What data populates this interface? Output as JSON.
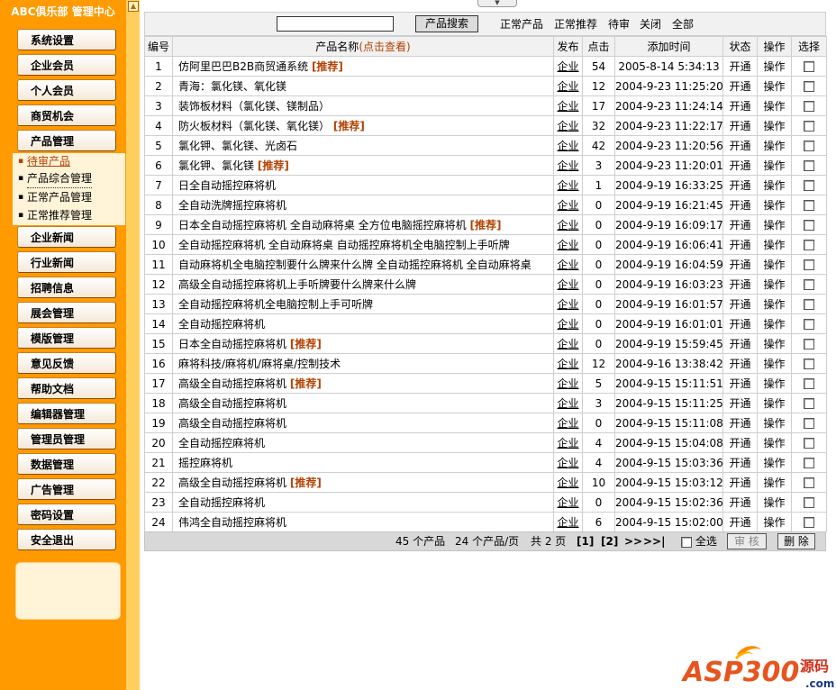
{
  "sidebar": {
    "title": "ABC俱乐部 管理中心",
    "menu": [
      {
        "label": "系统设置"
      },
      {
        "label": "企业会员"
      },
      {
        "label": "个人会员"
      },
      {
        "label": "商贸机会"
      },
      {
        "label": "产品管理"
      },
      {
        "label": "企业新闻"
      },
      {
        "label": "行业新闻"
      },
      {
        "label": "招聘信息"
      },
      {
        "label": "展会管理"
      },
      {
        "label": "模版管理"
      },
      {
        "label": "意见反馈"
      },
      {
        "label": "帮助文档"
      },
      {
        "label": "编辑器管理"
      },
      {
        "label": "管理员管理"
      },
      {
        "label": "数据管理"
      },
      {
        "label": "广告管理"
      },
      {
        "label": "密码设置"
      },
      {
        "label": "安全退出"
      }
    ],
    "submenu": [
      {
        "label": "待审产品",
        "active": true
      },
      {
        "label": "产品综合管理"
      },
      {
        "label": "正常产品管理"
      },
      {
        "label": "正常推荐管理"
      }
    ]
  },
  "search": {
    "value": "",
    "button_label": "产品搜索",
    "filters": [
      "正常产品",
      "正常推荐",
      "待审",
      "关闭",
      "全部"
    ]
  },
  "table": {
    "headers": {
      "id": "编号",
      "name": "产品名称",
      "name_hint": "(点击查看)",
      "publish": "发布",
      "clicks": "点击",
      "time": "添加时间",
      "status": "状态",
      "action": "操作",
      "select": "选择"
    },
    "tag_label": "[推荐]",
    "rows": [
      {
        "id": "1",
        "name": "仿阿里巴巴B2B商贸通系统",
        "recommended": true,
        "publish": "企业",
        "clicks": "54",
        "time": "2005-8-14 5:34:13",
        "status": "开通",
        "action": "操作"
      },
      {
        "id": "2",
        "name": "青海：氯化镁、氧化镁",
        "recommended": false,
        "publish": "企业",
        "clicks": "12",
        "time": "2004-9-23 11:25:20",
        "status": "开通",
        "action": "操作"
      },
      {
        "id": "3",
        "name": "装饰板材料（氯化镁、镁制品）",
        "recommended": false,
        "publish": "企业",
        "clicks": "17",
        "time": "2004-9-23 11:24:14",
        "status": "开通",
        "action": "操作"
      },
      {
        "id": "4",
        "name": "防火板材料（氯化镁、氧化镁）",
        "recommended": true,
        "publish": "企业",
        "clicks": "32",
        "time": "2004-9-23 11:22:17",
        "status": "开通",
        "action": "操作"
      },
      {
        "id": "5",
        "name": "氯化钾、氯化镁、光卤石",
        "recommended": false,
        "publish": "企业",
        "clicks": "42",
        "time": "2004-9-23 11:20:56",
        "status": "开通",
        "action": "操作"
      },
      {
        "id": "6",
        "name": "氯化钾、氯化镁",
        "recommended": true,
        "publish": "企业",
        "clicks": "3",
        "time": "2004-9-23 11:20:01",
        "status": "开通",
        "action": "操作"
      },
      {
        "id": "7",
        "name": "日全自动摇控麻将机",
        "recommended": false,
        "publish": "企业",
        "clicks": "1",
        "time": "2004-9-19 16:33:25",
        "status": "开通",
        "action": "操作"
      },
      {
        "id": "8",
        "name": "全自动洗牌摇控麻将机",
        "recommended": false,
        "publish": "企业",
        "clicks": "0",
        "time": "2004-9-19 16:21:45",
        "status": "开通",
        "action": "操作"
      },
      {
        "id": "9",
        "name": "日本全自动摇控麻将机 全自动麻将桌 全方位电脑摇控麻将机",
        "recommended": true,
        "publish": "企业",
        "clicks": "0",
        "time": "2004-9-19 16:09:17",
        "status": "开通",
        "action": "操作"
      },
      {
        "id": "10",
        "name": "全自动摇控麻将机 全自动麻将桌 自动摇控麻将机全电脑控制上手听牌",
        "recommended": false,
        "publish": "企业",
        "clicks": "0",
        "time": "2004-9-19 16:06:41",
        "status": "开通",
        "action": "操作"
      },
      {
        "id": "11",
        "name": "自动麻将机全电脑控制要什么牌来什么牌 全自动摇控麻将机 全自动麻将桌",
        "recommended": false,
        "publish": "企业",
        "clicks": "0",
        "time": "2004-9-19 16:04:59",
        "status": "开通",
        "action": "操作"
      },
      {
        "id": "12",
        "name": "高级全自动摇控麻将机上手听牌要什么牌来什么牌",
        "recommended": false,
        "publish": "企业",
        "clicks": "0",
        "time": "2004-9-19 16:03:23",
        "status": "开通",
        "action": "操作"
      },
      {
        "id": "13",
        "name": "全自动摇控麻将机全电脑控制上手可听牌",
        "recommended": false,
        "publish": "企业",
        "clicks": "0",
        "time": "2004-9-19 16:01:57",
        "status": "开通",
        "action": "操作"
      },
      {
        "id": "14",
        "name": "全自动摇控麻将机",
        "recommended": false,
        "publish": "企业",
        "clicks": "0",
        "time": "2004-9-19 16:01:01",
        "status": "开通",
        "action": "操作"
      },
      {
        "id": "15",
        "name": "日本全自动摇控麻将机",
        "recommended": true,
        "publish": "企业",
        "clicks": "0",
        "time": "2004-9-19 15:59:45",
        "status": "开通",
        "action": "操作"
      },
      {
        "id": "16",
        "name": "麻将科技/麻将机/麻将桌/控制技术",
        "recommended": false,
        "publish": "企业",
        "clicks": "12",
        "time": "2004-9-16 13:38:42",
        "status": "开通",
        "action": "操作"
      },
      {
        "id": "17",
        "name": "高级全自动摇控麻将机",
        "recommended": true,
        "publish": "企业",
        "clicks": "5",
        "time": "2004-9-15 15:11:51",
        "status": "开通",
        "action": "操作"
      },
      {
        "id": "18",
        "name": "高级全自动摇控麻将机",
        "recommended": false,
        "publish": "企业",
        "clicks": "3",
        "time": "2004-9-15 15:11:25",
        "status": "开通",
        "action": "操作"
      },
      {
        "id": "19",
        "name": "高级全自动摇控麻将机",
        "recommended": false,
        "publish": "企业",
        "clicks": "0",
        "time": "2004-9-15 15:11:08",
        "status": "开通",
        "action": "操作"
      },
      {
        "id": "20",
        "name": "全自动摇控麻将机",
        "recommended": false,
        "publish": "企业",
        "clicks": "4",
        "time": "2004-9-15 15:04:08",
        "status": "开通",
        "action": "操作"
      },
      {
        "id": "21",
        "name": "摇控麻将机",
        "recommended": false,
        "publish": "企业",
        "clicks": "4",
        "time": "2004-9-15 15:03:36",
        "status": "开通",
        "action": "操作"
      },
      {
        "id": "22",
        "name": "高级全自动摇控麻将机",
        "recommended": true,
        "publish": "企业",
        "clicks": "10",
        "time": "2004-9-15 15:03:12",
        "status": "开通",
        "action": "操作"
      },
      {
        "id": "23",
        "name": "全自动摇控麻将机",
        "recommended": false,
        "publish": "企业",
        "clicks": "0",
        "time": "2004-9-15 15:02:36",
        "status": "开通",
        "action": "操作"
      },
      {
        "id": "24",
        "name": "伟鸿全自动摇控麻将机",
        "recommended": false,
        "publish": "企业",
        "clicks": "6",
        "time": "2004-9-15 15:02:00",
        "status": "开通",
        "action": "操作"
      }
    ]
  },
  "pagination": {
    "total_text": "45 个产品",
    "per_page_text": "24 个产品/页",
    "pages_text": "共 2 页",
    "pages": [
      "[1]",
      "[2]"
    ],
    "next": ">>",
    "last": ">>|",
    "select_all_label": "全选",
    "approve_label": "审 核",
    "delete_label": "删 除"
  },
  "watermark": {
    "brand": "ASP300",
    "suffix": "源码",
    "domain": ".com"
  },
  "colors": {
    "sidebar_bg": "#ff9a00",
    "accent_text": "#b54000"
  }
}
